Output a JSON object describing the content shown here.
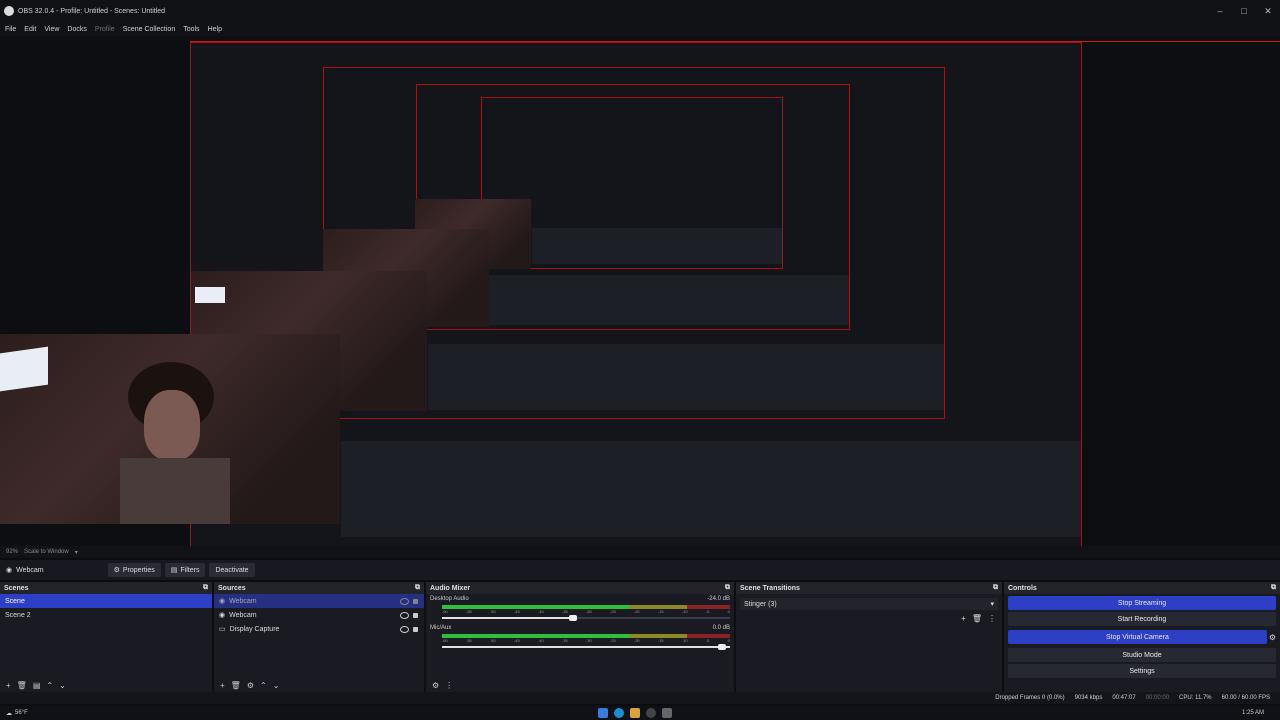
{
  "window": {
    "title": "OBS 32.0.4 - Profile: Untitled - Scenes: Untitled",
    "minimize": "–",
    "maximize": "□",
    "close": "✕"
  },
  "menu": [
    "File",
    "Edit",
    "View",
    "Docks",
    "Profile",
    "Scene Collection",
    "Tools",
    "Help"
  ],
  "preview_status": {
    "zoom": "92%",
    "scale_mode": "Scale to Window"
  },
  "context": {
    "source_name": "Webcam",
    "properties": "Properties",
    "filters": "Filters",
    "deactivate": "Deactivate"
  },
  "scenes": {
    "header": "Scenes",
    "items": [
      "Scene",
      "Scene 2"
    ],
    "selected": 0
  },
  "sources": {
    "header": "Sources",
    "items": [
      "Webcam",
      "Webcam",
      "Display Capture"
    ],
    "selected": 0
  },
  "audio": {
    "header": "Audio Mixer",
    "channels": [
      {
        "name": "Desktop Audio",
        "db": "-24.0 dB",
        "volume": 0.8,
        "level": 0.55
      },
      {
        "name": "Mic/Aux",
        "db": "0.0 dB",
        "volume": 1.0,
        "level": 0.68
      }
    ],
    "scale": [
      "-60",
      "-55",
      "-50",
      "-45",
      "-40",
      "-35",
      "-30",
      "-25",
      "-20",
      "-15",
      "-10",
      "-5",
      "0"
    ]
  },
  "transitions": {
    "header": "Scene Transitions",
    "selected": "Stinger (3)"
  },
  "controls": {
    "header": "Controls",
    "buttons": [
      "Stop Streaming",
      "Start Recording",
      "Stop Virtual Camera",
      "Studio Mode",
      "Settings"
    ],
    "active": [
      0,
      2
    ]
  },
  "status": {
    "dropped": "Dropped Frames 0 (0.0%)",
    "bitrate": "9034 kbps",
    "stream_time": "00:47:07",
    "rec_time": "00:00:00",
    "cpu": "CPU: 11.7%",
    "fps": "60.00 / 60.00 FPS"
  },
  "taskbar": {
    "weather": "56°F",
    "time": "1:25 AM"
  },
  "colors": {
    "accent": "#2d3fc4",
    "border_red": "#d01818",
    "panel": "#1a1b22"
  }
}
